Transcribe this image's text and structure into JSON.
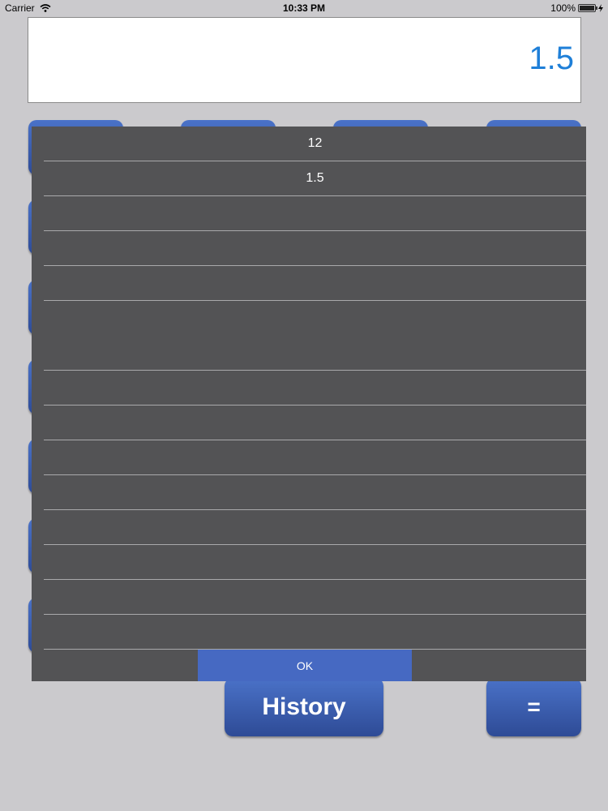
{
  "status_bar": {
    "carrier": "Carrier",
    "time": "10:33 PM",
    "battery": "100%"
  },
  "display": {
    "value": "1.5"
  },
  "history": {
    "entries": [
      "12",
      "1.5",
      "",
      "",
      "",
      "",
      "",
      "",
      "",
      "",
      "",
      "",
      "",
      "",
      ""
    ],
    "ok_label": "OK"
  },
  "buttons": {
    "history_label": "History",
    "equals_label": "="
  },
  "colors": {
    "accent": "#1e7fd8",
    "button": "#3a5cb0",
    "overlay": "#535355"
  }
}
